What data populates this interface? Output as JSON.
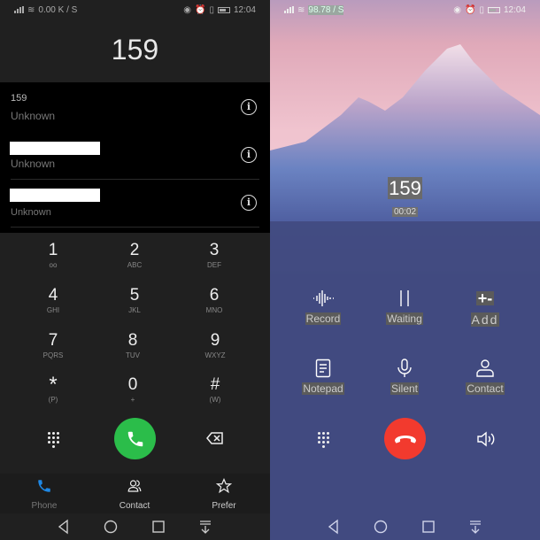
{
  "left_screen": {
    "status": {
      "speed": "0.00 K / S",
      "time": "12:04"
    },
    "dialed_number": "159",
    "recent_calls": [
      {
        "number": "159",
        "label": "Unknown",
        "redacted": false
      },
      {
        "number": "",
        "label": "Unknown",
        "redacted": true
      },
      {
        "number": "",
        "label": "Unknown",
        "redacted": true
      }
    ],
    "keypad": [
      {
        "digit": "1",
        "letters": "oo"
      },
      {
        "digit": "2",
        "letters": "ABC"
      },
      {
        "digit": "3",
        "letters": "DEF"
      },
      {
        "digit": "4",
        "letters": "GHI"
      },
      {
        "digit": "5",
        "letters": "JKL"
      },
      {
        "digit": "6",
        "letters": "MNO"
      },
      {
        "digit": "7",
        "letters": "PQRS"
      },
      {
        "digit": "8",
        "letters": "TUV"
      },
      {
        "digit": "9",
        "letters": "WXYZ"
      },
      {
        "digit": "*",
        "letters": "(P)"
      },
      {
        "digit": "0",
        "letters": "+"
      },
      {
        "digit": "#",
        "letters": "(W)"
      }
    ],
    "tabs": [
      {
        "label": "Phone",
        "icon": "phone-icon",
        "active": true
      },
      {
        "label": "Contact",
        "icon": "contacts-icon",
        "active": false
      },
      {
        "label": "Prefer",
        "icon": "star-icon",
        "active": false
      }
    ],
    "colors": {
      "call_button": "#2bbd4a",
      "active_tab": "#1e88e5"
    }
  },
  "right_screen": {
    "status": {
      "speed": "98.78 / S",
      "time": "12:04"
    },
    "caller_number": "159",
    "call_duration": "00:02",
    "actions": [
      {
        "label": "Record",
        "icon": "record-waveform-icon"
      },
      {
        "label": "Waiting",
        "icon": "pause-icon"
      },
      {
        "label": "Add",
        "icon": "add-call-icon"
      },
      {
        "label": "Notepad",
        "icon": "notepad-icon"
      },
      {
        "label": "Silent",
        "icon": "microphone-icon"
      },
      {
        "label": "Contact",
        "icon": "contact-icon"
      }
    ],
    "colors": {
      "end_call_button": "#f23a2e",
      "background": "#414a80"
    }
  }
}
